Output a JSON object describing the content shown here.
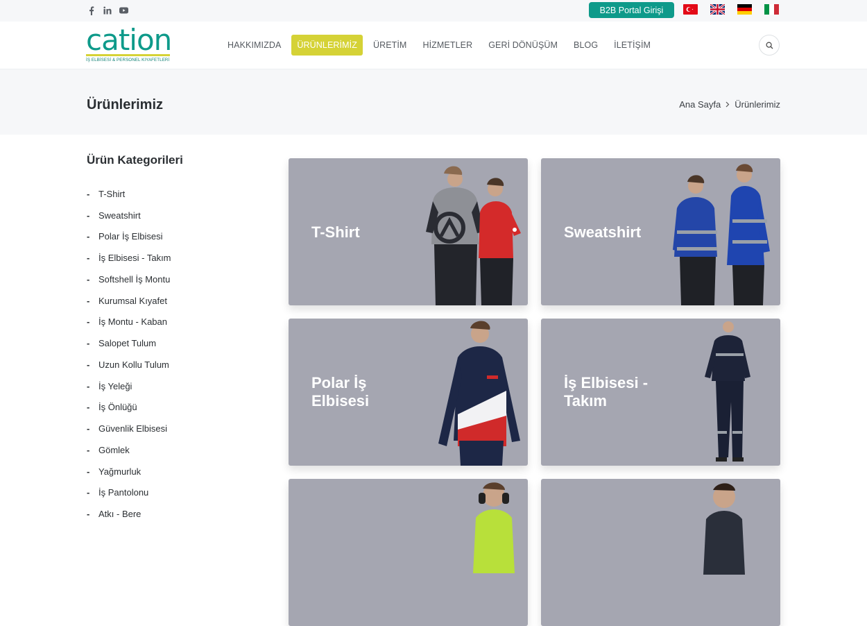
{
  "topbar": {
    "social": [
      "facebook-icon",
      "linkedin-icon",
      "youtube-icon"
    ],
    "b2b_label": "B2B Portal Girişi",
    "flags": [
      "flag-tr-icon",
      "flag-uk-icon",
      "flag-de-icon",
      "flag-it-icon"
    ]
  },
  "header": {
    "logo_word": "cation",
    "logo_tagline": "İŞ ELBİSESİ & PERSONEL KIYAFETLERİ",
    "nav": [
      "HAKKIMIZDA",
      "ÜRÜNLERİMİZ",
      "ÜRETİM",
      "HİZMETLER",
      "GERİ DÖNÜŞÜM",
      "BLOG",
      "İLETİŞİM"
    ],
    "active_nav": "ÜRÜNLERİMİZ"
  },
  "page": {
    "title": "Ürünlerimiz",
    "breadcrumb": [
      "Ana Sayfa",
      "Ürünlerimiz"
    ]
  },
  "sidebar": {
    "title": "Ürün Kategorileri",
    "items": [
      "T-Shirt",
      "Sweatshirt",
      "Polar İş Elbisesi",
      "İş Elbisesi - Takım",
      "Softshell İş Montu",
      "Kurumsal Kıyafet",
      "İş Montu - Kaban",
      "Salopet Tulum",
      "Uzun Kollu Tulum",
      "İş Yeleği",
      "İş Önlüğü",
      "Güvenlik Elbisesi",
      "Gömlek",
      "Yağmurluk",
      "İş Pantolonu",
      "Atkı - Bere"
    ]
  },
  "products": [
    {
      "line1": "T-Shirt",
      "line2": ""
    },
    {
      "line1": "Sweatshirt",
      "line2": ""
    },
    {
      "line1": "Polar İş",
      "line2": "Elbisesi"
    },
    {
      "line1": "İş Elbisesi -",
      "line2": "Takım"
    },
    {
      "line1": "",
      "line2": ""
    },
    {
      "line1": "",
      "line2": ""
    }
  ],
  "colors": {
    "brand_teal": "#0e9a8a",
    "brand_yellow": "#d5d236",
    "card_bg": "#a5a6b1"
  }
}
